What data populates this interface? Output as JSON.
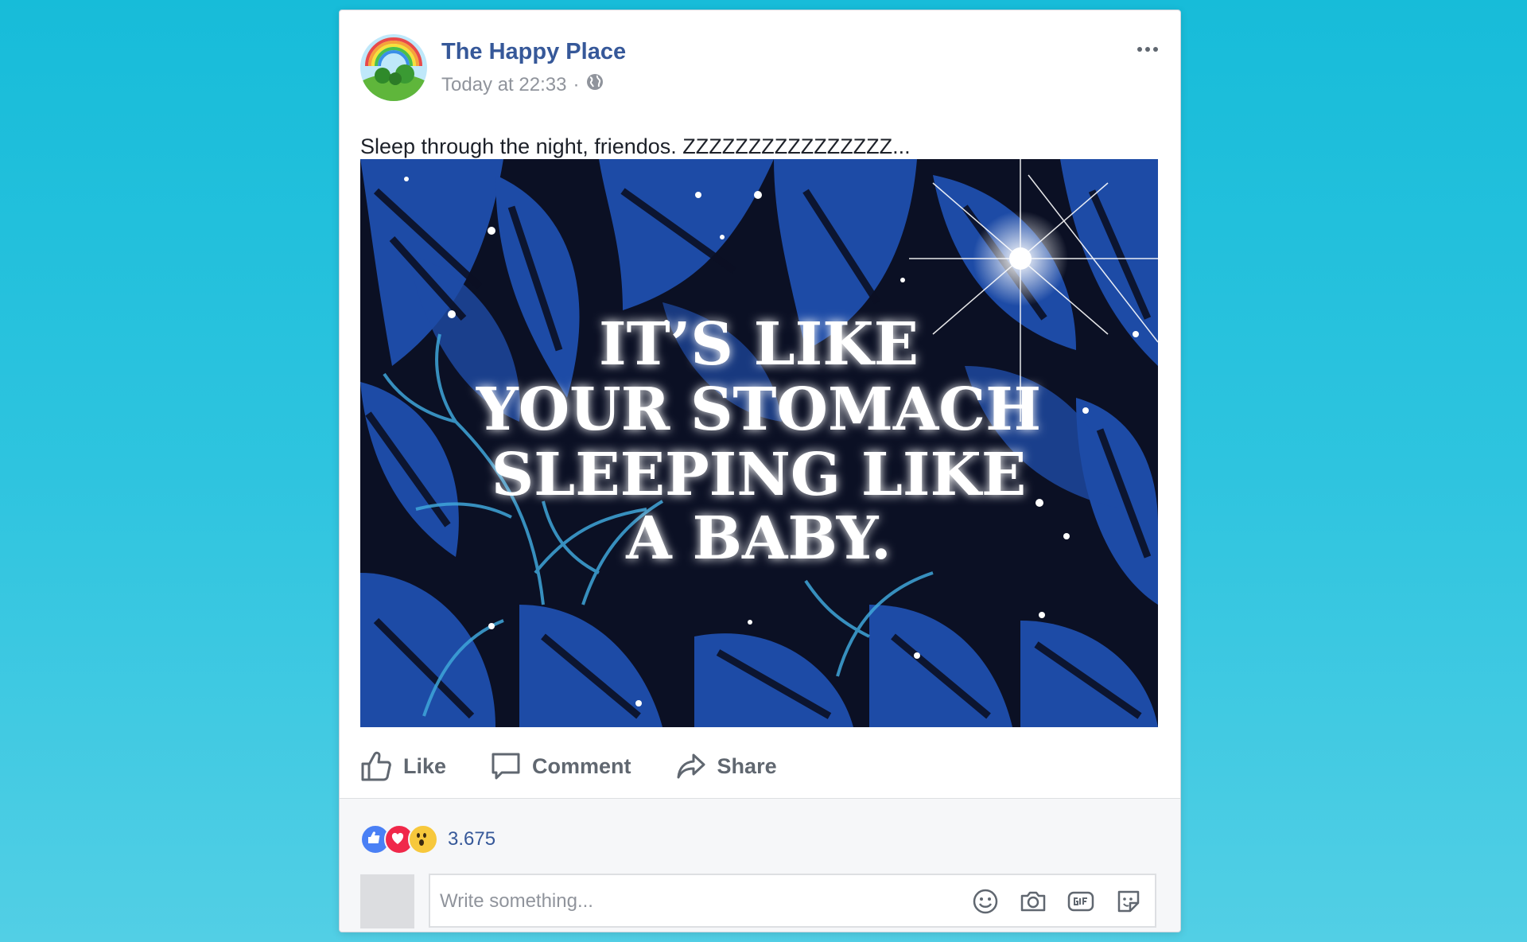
{
  "post": {
    "page_name": "The Happy Place",
    "timestamp": "Today at 22:33",
    "separator": "·",
    "privacy_icon": "globe-icon",
    "more_icon": "more-options-icon",
    "text": "Sleep through the night, friendos. ZZZZZZZZZZZZZZZZ...",
    "image": {
      "lines": [
        "IT’S LIKE",
        "YOUR STOMACH",
        "SLEEPING LIKE",
        "A BABY."
      ],
      "colors": {
        "background": "#0f2a6e",
        "leaf_dark": "#0b1024",
        "leaf_light": "#2156b8",
        "branch": "#3fa6d9",
        "text": "#ffffff"
      }
    }
  },
  "actions": [
    {
      "label": "Like",
      "icon": "thumbs-up-icon"
    },
    {
      "label": "Comment",
      "icon": "comment-icon"
    },
    {
      "label": "Share",
      "icon": "share-icon"
    }
  ],
  "reactions": {
    "icons": [
      "like-reaction-icon",
      "love-reaction-icon",
      "wow-reaction-icon"
    ],
    "count": "3.675",
    "colors": {
      "like": "#4a80f5",
      "love": "#f0284a",
      "wow": "#f7c83c"
    }
  },
  "comment": {
    "placeholder": "Write something...",
    "tools": [
      "emoji-icon",
      "camera-icon",
      "gif-icon",
      "sticker-icon"
    ]
  },
  "colors": {
    "accent": "#365899",
    "muted": "#90949c",
    "action": "#606770"
  }
}
